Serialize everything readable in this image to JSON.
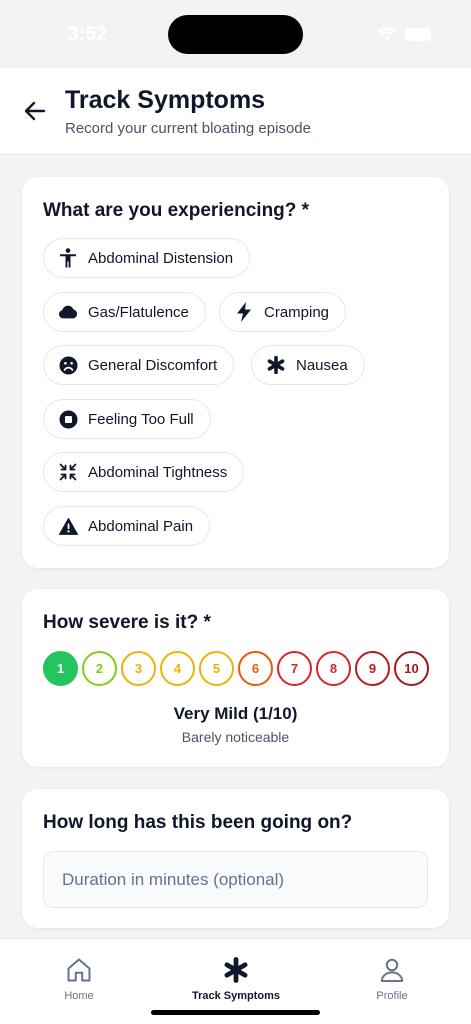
{
  "status_bar": {
    "time": "3:52"
  },
  "header": {
    "title": "Track Symptoms",
    "subtitle": "Record your current bloating episode"
  },
  "symptoms": {
    "title": "What are you experiencing? *",
    "items": [
      {
        "label": "Abdominal Distension",
        "icon": "person-standing-icon"
      },
      {
        "label": "Gas/Flatulence",
        "icon": "cloud-icon"
      },
      {
        "label": "Cramping",
        "icon": "lightning-bolt-icon"
      },
      {
        "label": "General Discomfort",
        "icon": "frown-face-icon"
      },
      {
        "label": "Nausea",
        "icon": "asterisk-icon"
      },
      {
        "label": "Feeling Too Full",
        "icon": "stop-circle-icon"
      },
      {
        "label": "Abdominal Tightness",
        "icon": "compress-arrows-icon"
      },
      {
        "label": "Abdominal Pain",
        "icon": "warning-triangle-icon"
      }
    ]
  },
  "severity": {
    "title": "How severe is it? *",
    "selected": 1,
    "levels": [
      {
        "value": "1",
        "color": "#22c55e"
      },
      {
        "value": "2",
        "color": "#84cc16"
      },
      {
        "value": "3",
        "color": "#eab308"
      },
      {
        "value": "4",
        "color": "#eab308"
      },
      {
        "value": "5",
        "color": "#eab308"
      },
      {
        "value": "6",
        "color": "#ea580c"
      },
      {
        "value": "7",
        "color": "#dc2626"
      },
      {
        "value": "8",
        "color": "#dc2626"
      },
      {
        "value": "9",
        "color": "#b91c1c"
      },
      {
        "value": "10",
        "color": "#991b1b"
      }
    ],
    "selected_label": "Very Mild (1/10)",
    "selected_description": "Barely noticeable"
  },
  "duration": {
    "title": "How long has this been going on?",
    "placeholder": "Duration in minutes (optional)",
    "value": ""
  },
  "tab_bar": {
    "tabs": [
      {
        "label": "Home",
        "icon": "home-icon",
        "active": false
      },
      {
        "label": "Track Symptoms",
        "icon": "asterisk-icon",
        "active": true
      },
      {
        "label": "Profile",
        "icon": "user-icon",
        "active": false
      }
    ]
  }
}
